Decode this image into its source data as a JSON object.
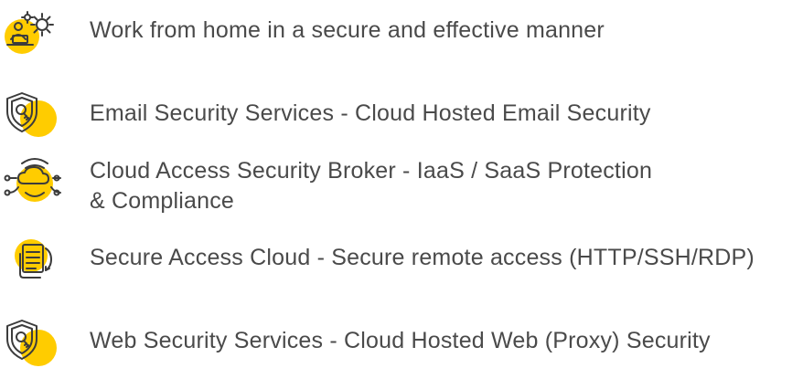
{
  "colors": {
    "accent": "#FFCC00",
    "text": "#4A4A4A",
    "icon_stroke": "#3C3C3C"
  },
  "features": [
    {
      "icon": "remote-work-gear-icon",
      "lines": [
        "Work from home in a secure and effective manner"
      ]
    },
    {
      "icon": "shield-key-icon",
      "lines": [
        "Email Security Services - Cloud Hosted Email Security"
      ]
    },
    {
      "icon": "cloud-network-icon",
      "lines": [
        "Cloud Access Security Broker - IaaS / SaaS Protection",
        "& Compliance"
      ]
    },
    {
      "icon": "secure-document-icon",
      "lines": [
        "Secure Access Cloud - Secure remote access (HTTP/SSH/RDP)"
      ]
    },
    {
      "icon": "shield-key-icon",
      "lines": [
        "Web Security Services - Cloud Hosted Web (Proxy) Security"
      ]
    }
  ]
}
